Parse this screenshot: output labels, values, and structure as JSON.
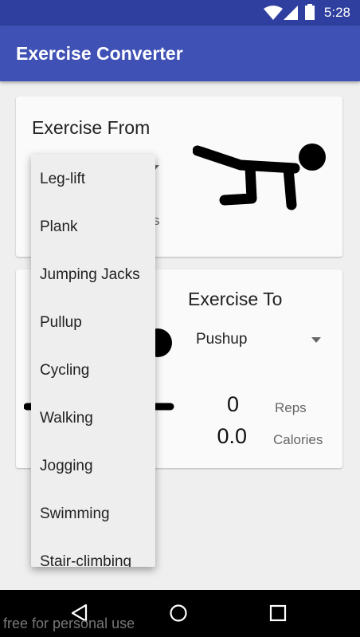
{
  "status": {
    "time": "5:28"
  },
  "app": {
    "title": "Exercise Converter"
  },
  "from_card": {
    "heading": "Exercise From",
    "partial_unit": "s"
  },
  "to_card": {
    "heading": "Exercise To",
    "selected": "Pushup",
    "reps_value": "0",
    "reps_label": "Reps",
    "calories_value": "0.0",
    "calories_label": "Calories"
  },
  "dropdown": {
    "options": [
      "Leg-lift",
      "Plank",
      "Jumping Jacks",
      "Pullup",
      "Cycling",
      "Walking",
      "Jogging",
      "Swimming",
      "Stair-climbing"
    ]
  },
  "watermark": "free for personal use",
  "icons": [
    "wifi-icon",
    "signal-icon",
    "battery-icon",
    "plank-figure-icon",
    "pushup-figure-icon",
    "back-icon",
    "home-icon",
    "recents-icon"
  ]
}
